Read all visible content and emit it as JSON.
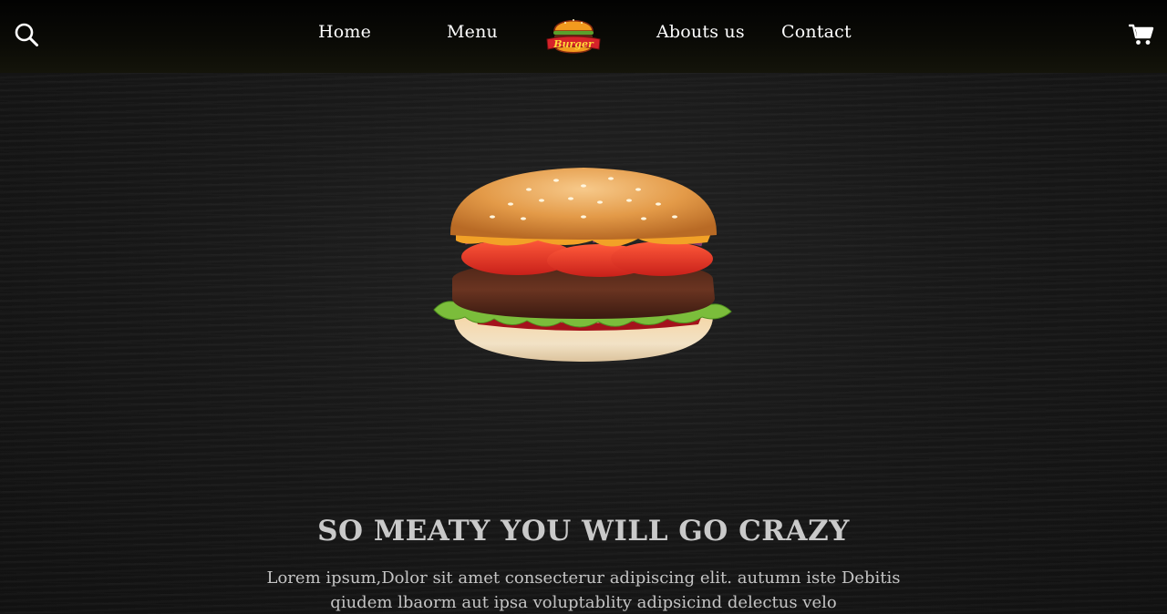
{
  "header": {
    "search_icon": "search-icon",
    "cart_icon": "cart-icon",
    "nav": [
      {
        "label": "Home"
      },
      {
        "label": "Menu"
      },
      {
        "label": "Abouts us"
      },
      {
        "label": "Contact"
      }
    ],
    "logo": {
      "text": "Burger",
      "icon": "burger-logo-icon"
    }
  },
  "hero": {
    "image": "burger-image",
    "headline": "SO MEATY YOU WILL GO CRAZY",
    "body": "Lorem ipsum,Dolor sit amet consecterur adipiscing elit. autumn iste Debitis qiudem lbaorm aut ipsa voluptablity adipsicind delectus velo"
  },
  "colors": {
    "background": "#161616",
    "header": "#0a0a06",
    "nav_text": "#ffffff",
    "hero_text": "#c9c9c9",
    "logo_red": "#d6232a",
    "logo_orange": "#f39a1e"
  }
}
